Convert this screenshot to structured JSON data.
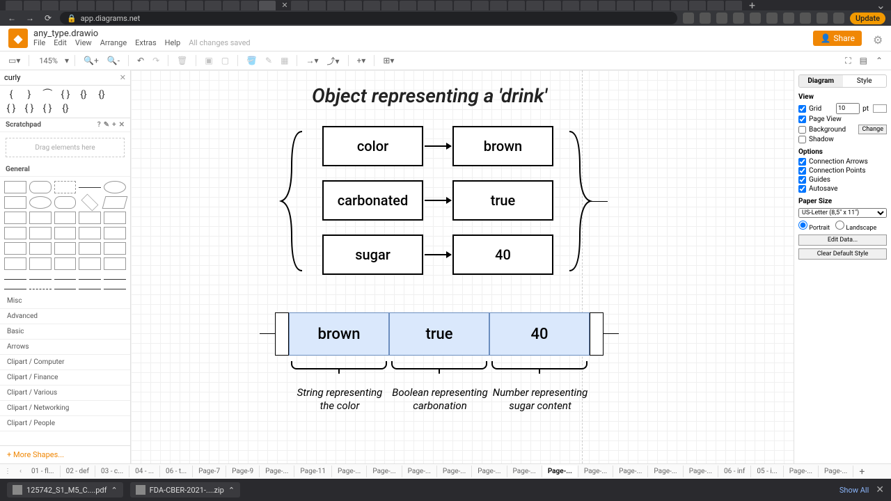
{
  "browser": {
    "url": "app.diagrams.net",
    "update": "Update"
  },
  "file": {
    "title": "any_type.drawio",
    "saved": "All changes saved"
  },
  "menu": [
    "File",
    "Edit",
    "View",
    "Arrange",
    "Extras",
    "Help"
  ],
  "share": "Share",
  "toolbar": {
    "zoom": "145%"
  },
  "search": {
    "value": "curly"
  },
  "scratchpad": {
    "label": "Scratchpad",
    "hint": "Drag elements here"
  },
  "general": "General",
  "categories": [
    "Misc",
    "Advanced",
    "Basic",
    "Arrows",
    "Clipart / Computer",
    "Clipart / Finance",
    "Clipart / Various",
    "Clipart / Networking",
    "Clipart / People"
  ],
  "more_shapes": "+ More Shapes...",
  "canvas": {
    "title": "Object representing a 'drink'",
    "rows": [
      {
        "key": "color",
        "val": "brown"
      },
      {
        "key": "carbonated",
        "val": "true"
      },
      {
        "key": "sugar",
        "val": "40"
      }
    ],
    "list": [
      "brown",
      "true",
      "40"
    ],
    "captions": [
      "String representing the color",
      "Boolean representing carbonation",
      "Number representing sugar content"
    ]
  },
  "panel": {
    "tabs": [
      "Diagram",
      "Style"
    ],
    "view": "View",
    "grid": "Grid",
    "grid_val": "10",
    "grid_unit": "pt",
    "page_view": "Page View",
    "background": "Background",
    "change": "Change",
    "shadow": "Shadow",
    "options": "Options",
    "conn_arrows": "Connection Arrows",
    "conn_points": "Connection Points",
    "guides": "Guides",
    "autosave": "Autosave",
    "paper": "Paper Size",
    "paper_val": "US-Letter (8,5\" x 11\")",
    "portrait": "Portrait",
    "landscape": "Landscape",
    "edit_data": "Edit Data...",
    "clear_style": "Clear Default Style"
  },
  "pages": [
    "01 - fl...",
    "02 - def",
    "03 - c...",
    "04 - ...",
    "06 - t...",
    "Page-7",
    "Page-9",
    "Page-...",
    "Page-11",
    "Page-...",
    "Page-...",
    "Page-...",
    "Page-...",
    "Page-...",
    "Page-...",
    "Page-...",
    "Page-...",
    "Page-...",
    "Page-...",
    "Page-...",
    "06 - inf",
    "05 - i...",
    "Page-...",
    "Page-..."
  ],
  "active_page": 15,
  "downloads": {
    "items": [
      "125742_S1_M5_C....pdf",
      "FDA-CBER-2021-....zip"
    ],
    "show_all": "Show All"
  }
}
